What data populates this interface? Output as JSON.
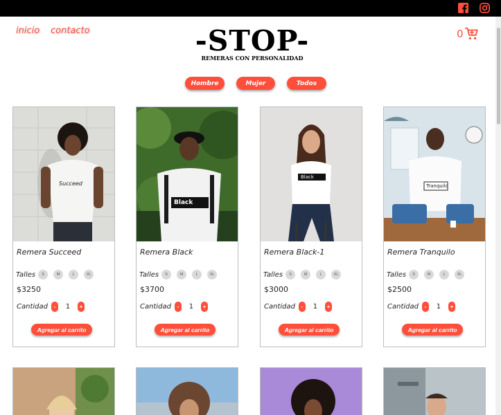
{
  "colors": {
    "accent": "#ff4f3b",
    "topbar": "#000000"
  },
  "topbar": {
    "icons": [
      "facebook-icon",
      "instagram-icon"
    ]
  },
  "nav": {
    "inicio": "inicio",
    "contacto": "contacto"
  },
  "logo": {
    "title": "-STOP-",
    "subtitle": "REMERAS CON PERSONALIDAD"
  },
  "cart": {
    "count": "0",
    "icon": "shopping-cart-icon"
  },
  "filters": [
    "Hombre",
    "Mujer",
    "Todos"
  ],
  "labels": {
    "sizes": "Talles",
    "quantity": "Cantidad",
    "add_to_cart": "Agregar al carrito",
    "minus": "-",
    "plus": "+"
  },
  "sizes": [
    "S",
    "M",
    "L",
    "XL"
  ],
  "products": [
    {
      "name": "Remera Succeed",
      "price": "$3250",
      "qty": "1",
      "shirt_text": "Succeed"
    },
    {
      "name": "Remera Black",
      "price": "$3700",
      "qty": "1",
      "shirt_text": "Black"
    },
    {
      "name": "Remera Black-1",
      "price": "$3000",
      "qty": "1",
      "shirt_text": "Black"
    },
    {
      "name": "Remera Tranquilo",
      "price": "$2500",
      "qty": "1",
      "shirt_text": "Tranquilo"
    }
  ]
}
